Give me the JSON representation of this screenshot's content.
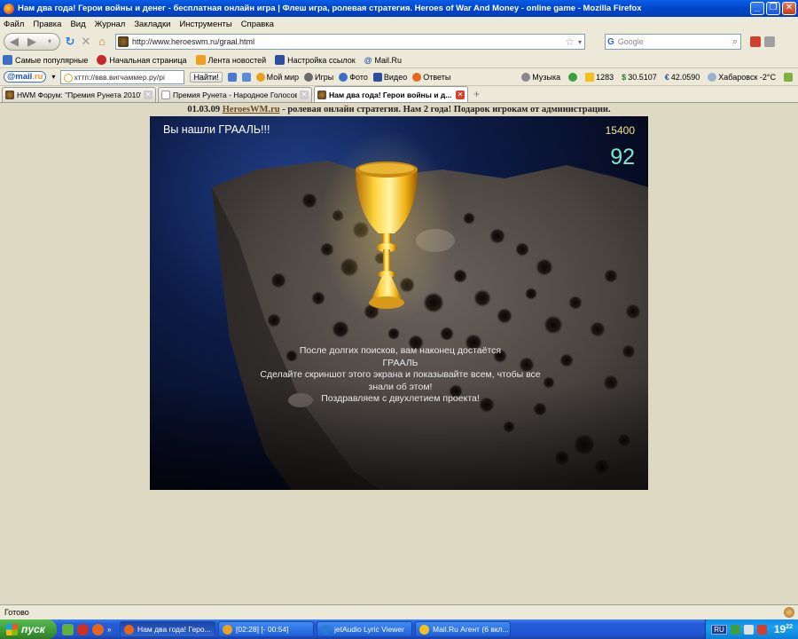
{
  "window": {
    "title": "Нам два года! Герои войны и денег - бесплатная онлайн игра | Флеш игра, ролевая стратегия. Heroes of War And Money - online game - Mozilla Firefox"
  },
  "menu": [
    "Файл",
    "Правка",
    "Вид",
    "Журнал",
    "Закладки",
    "Инструменты",
    "Справка"
  ],
  "nav": {
    "url": "http://www.heroeswm.ru/graal.html",
    "search_placeholder": "Google"
  },
  "bookmarks": [
    {
      "label": "Самые популярные",
      "color": "#3a6fc4"
    },
    {
      "label": "Начальная страница",
      "color": "#c62828"
    },
    {
      "label": "Лента новостей",
      "color": "#f0a020"
    },
    {
      "label": "Настройка ссылок",
      "color": "#2a4fa0"
    },
    {
      "label": "Mail.Ru",
      "color": "#1a4fb0"
    }
  ],
  "mailru": {
    "logo_main": "@mail",
    "logo_suffix": ".ru",
    "search_value": "хттп://ввв.вигчаммер.ру/рі",
    "find_label": "Найти!",
    "items": [
      "Мой мир",
      "Игры",
      "Фото",
      "Видео",
      "Ответы"
    ],
    "right_items": [
      "Музыка",
      "1283",
      "30.5107",
      "42.0590",
      "Хабаровск -2°C"
    ]
  },
  "tabs": [
    {
      "label": "HWM Форум: \"Премия Рунета 2010\". ...",
      "active": false
    },
    {
      "label": "Премия Рунета - Народное Голосова...",
      "active": false
    },
    {
      "label": "Нам два года! Герои войны и д...",
      "active": true
    }
  ],
  "page": {
    "banner_date": "01.03.09",
    "banner_link": "HeroesWM.ru",
    "banner_text": "- ролевая онлайн стратегия. Нам 2 года! Подарок игрокам от администрации.",
    "game": {
      "found": "Вы нашли ГРААЛЬ!!!",
      "score": "15400",
      "timer": "92",
      "message": [
        "После долгих поисков, вам наконец достаётся",
        "ГРААЛЬ",
        "Сделайте скриншот этого экрана и показывайте всем, чтобы все",
        "знали об этом!",
        "Поздравляем с двухлетием проекта!"
      ]
    }
  },
  "status": {
    "text": "Готово"
  },
  "taskbar": {
    "start_label": "пуск",
    "tasks": [
      {
        "label": "Нам два года! Геро...",
        "active": true,
        "color": "#e8661a"
      },
      {
        "label": "[02:28] [- 00:54]",
        "active": false,
        "color": "#f0a020"
      },
      {
        "label": "jetAudio Lyric Viewer",
        "active": false,
        "color": "#2a7ad4"
      },
      {
        "label": "Mail.Ru Агент (6 вкл...",
        "active": false,
        "color": "#f0c020"
      }
    ],
    "lang": "RU",
    "clock": "19",
    "clock_minutes": "22"
  }
}
